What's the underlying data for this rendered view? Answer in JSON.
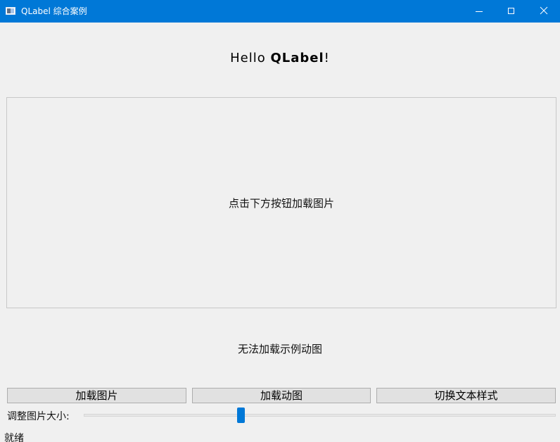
{
  "window": {
    "title": "QLabel 综合案例",
    "controls": {
      "minimize": "minimize-icon",
      "maximize": "maximize-icon",
      "close": "close-icon"
    }
  },
  "header": {
    "hello_prefix": "Hello ",
    "hello_bold": "QLabel",
    "hello_suffix": "!"
  },
  "image_area": {
    "placeholder": "点击下方按钮加载图片"
  },
  "movie_area": {
    "message": "无法加载示例动图"
  },
  "buttons": {
    "load_image": "加载图片",
    "load_movie": "加载动图",
    "toggle_style": "切换文本样式"
  },
  "slider": {
    "label": "调整图片大小:",
    "value_fraction": 0.33
  },
  "status": {
    "text": "就绪"
  },
  "colors": {
    "titlebar": "#0078d7",
    "background": "#f0f0f0",
    "button": "#e1e1e1",
    "slider_handle": "#0078d7"
  }
}
